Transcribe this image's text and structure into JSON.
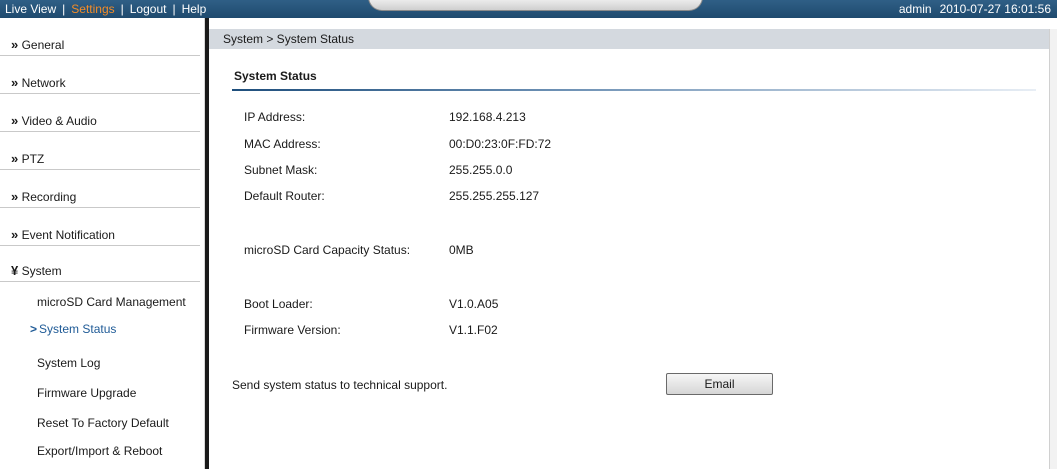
{
  "topbar": {
    "nav": {
      "live_view": "Live View",
      "settings": "Settings",
      "logout": "Logout",
      "help": "Help",
      "separator": "|"
    },
    "user": "admin",
    "datetime": "2010-07-27  16:01:56",
    "active_color": "#f28c28"
  },
  "sidebar": {
    "chevron_collapsed": "»",
    "chevron_expanded": "¥",
    "items": [
      {
        "label": "General"
      },
      {
        "label": "Network"
      },
      {
        "label": "Video & Audio"
      },
      {
        "label": "PTZ"
      },
      {
        "label": "Recording"
      },
      {
        "label": "Event Notification"
      },
      {
        "label": "System"
      }
    ],
    "system_subitems": [
      {
        "label": "microSD Card Management"
      },
      {
        "label": "System Status",
        "selected": true
      },
      {
        "label": "System Log"
      },
      {
        "label": "Firmware Upgrade"
      },
      {
        "label": "Reset To Factory Default"
      },
      {
        "label": "Export/Import & Reboot"
      }
    ]
  },
  "main": {
    "breadcrumb": "System > System Status",
    "section_title": "System Status",
    "network_info": [
      {
        "label": "IP Address:",
        "value": "192.168.4.213"
      },
      {
        "label": "MAC Address:",
        "value": "00:D0:23:0F:FD:72"
      },
      {
        "label": "Subnet Mask:",
        "value": "255.255.0.0"
      },
      {
        "label": "Default Router:",
        "value": "255.255.255.127"
      }
    ],
    "storage_info": {
      "label": "microSD Card Capacity Status:",
      "value": "0MB"
    },
    "version_info": [
      {
        "label": "Boot Loader:",
        "value": "V1.0.A05"
      },
      {
        "label": "Firmware Version:",
        "value": "V1.1.F02"
      }
    ],
    "support_text": "Send system status to technical support.",
    "email_button": "Email"
  }
}
